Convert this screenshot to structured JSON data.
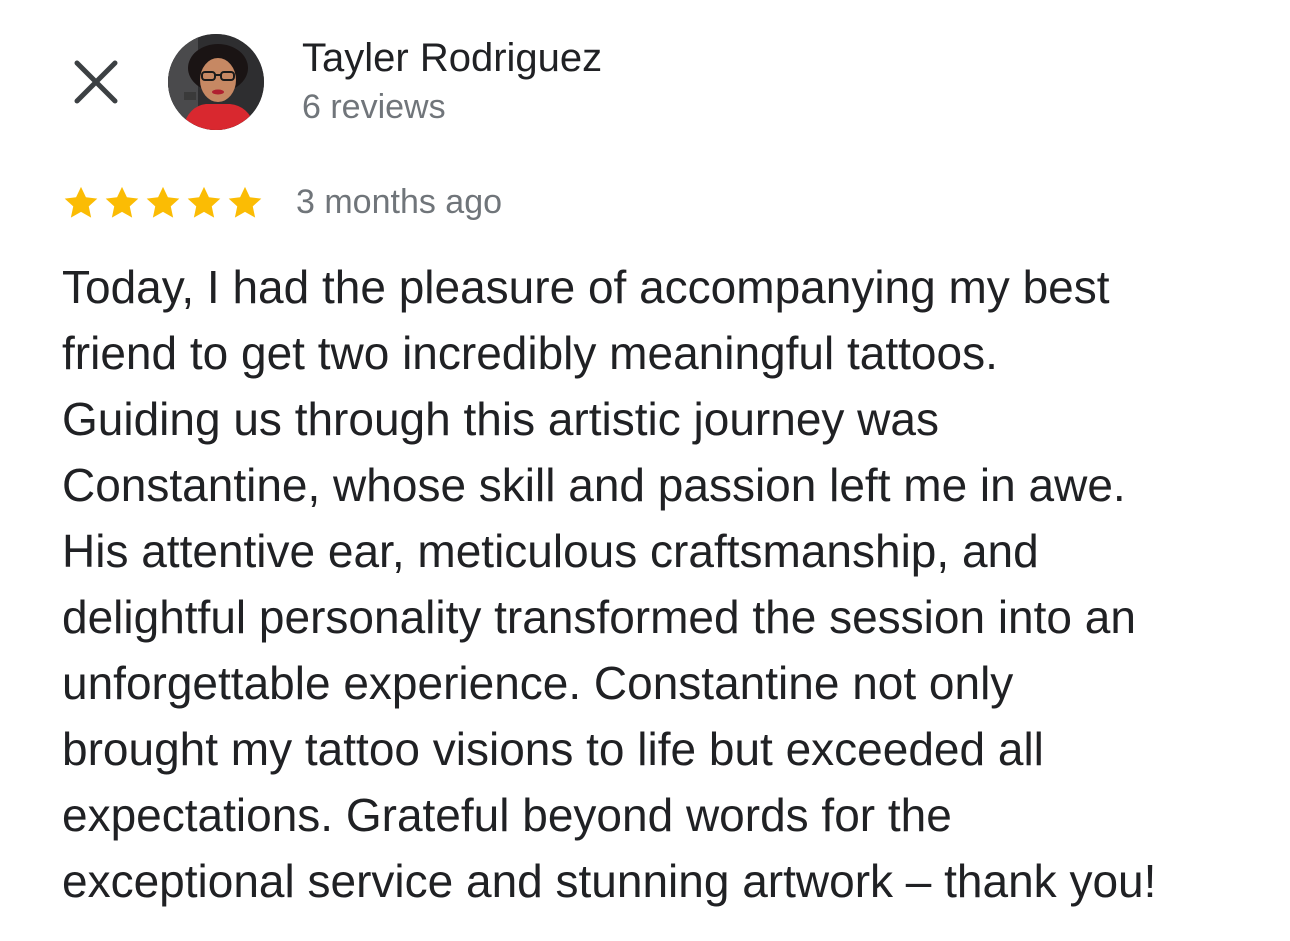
{
  "header": {
    "close_icon": "close-icon",
    "author_name": "Tayler Rodriguez",
    "review_count": "6 reviews"
  },
  "rating": {
    "stars": 5,
    "max_stars": 5,
    "star_color": "#FBBC04",
    "time_ago": "3 months ago"
  },
  "review": {
    "lines": [
      "Today, I had the pleasure of accompanying my best",
      "friend to get two incredibly meaningful tattoos.",
      "Guiding us through this artistic journey was",
      "Constantine, whose skill and passion left me in awe.",
      "His attentive ear, meticulous craftsmanship, and",
      "delightful personality transformed the session into an",
      "unforgettable experience. Constantine not only",
      "brought my tattoo visions to life but exceeded all",
      "expectations. Grateful beyond words for the",
      "exceptional service and stunning artwork – thank you!"
    ]
  }
}
